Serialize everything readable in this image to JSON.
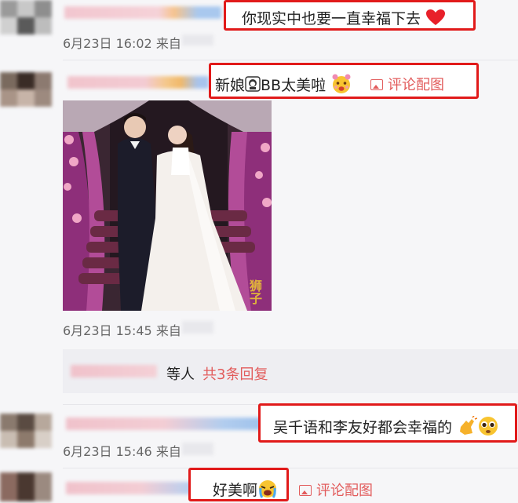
{
  "comments": [
    {
      "text": "你现实中也要一直幸福下去",
      "emoji": "red-heart",
      "time": "6月23日 16:02",
      "source": "来自"
    },
    {
      "text": "新娘",
      "text_tail": "BB太美啦",
      "emoji": "smiling-face-with-flowers",
      "link": "评论配图",
      "time": "6月23日 15:45",
      "source": "来自",
      "replies_suffix": "等人",
      "replies_link": "共3条回复",
      "photo_watermark": "狮子"
    },
    {
      "text": "吴千语和李友好都会幸福的",
      "emoji": "clapping-pleading",
      "time": "6月23日 15:46",
      "source": "来自"
    },
    {
      "text": "好美啊",
      "emoji": "crying-face",
      "link": "评论配图"
    }
  ],
  "colors": {
    "highlight_border": "#e11a1a",
    "link": "#e25c5c",
    "background": "#f6f6f8"
  }
}
